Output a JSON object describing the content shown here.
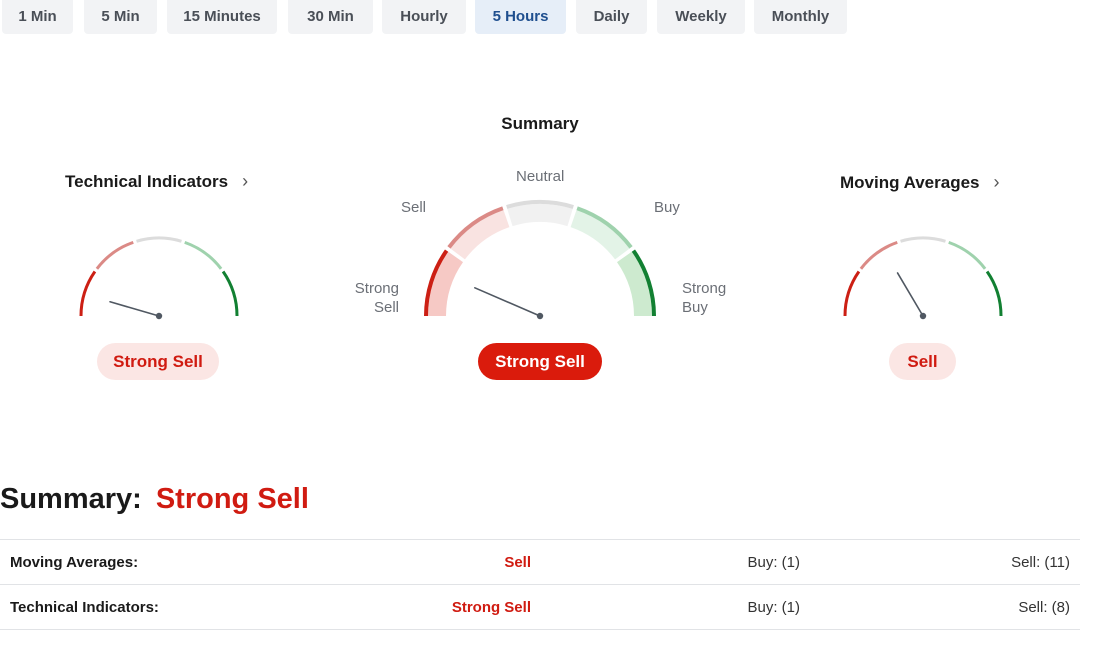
{
  "timeframes": [
    {
      "label": "1 Min",
      "active": false
    },
    {
      "label": "5 Min",
      "active": false
    },
    {
      "label": "15 Minutes",
      "active": false
    },
    {
      "label": "30 Min",
      "active": false
    },
    {
      "label": "Hourly",
      "active": false
    },
    {
      "label": "5 Hours",
      "active": true
    },
    {
      "label": "Daily",
      "active": false
    },
    {
      "label": "Weekly",
      "active": false
    },
    {
      "label": "Monthly",
      "active": false
    }
  ],
  "gauges": {
    "summary": {
      "title": "Summary",
      "labels": {
        "neutral": "Neutral",
        "sell": "Sell",
        "buy": "Buy",
        "strong_sell": "Strong\nSell",
        "strong_buy": "Strong\nBuy"
      },
      "result": "Strong Sell",
      "needle_level": 0.13
    },
    "technical": {
      "title": "Technical Indicators",
      "result": "Strong Sell",
      "needle_level": 0.09
    },
    "moving": {
      "title": "Moving Averages",
      "result": "Sell",
      "needle_level": 0.33
    }
  },
  "summary": {
    "label": "Summary:",
    "value": "Strong Sell"
  },
  "table": {
    "rows": [
      {
        "name": "Moving Averages:",
        "status": "Sell",
        "buy": "Buy: (1)",
        "sell": "Sell: (11)"
      },
      {
        "name": "Technical Indicators:",
        "status": "Strong Sell",
        "buy": "Buy: (1)",
        "sell": "Sell: (8)"
      }
    ]
  },
  "colors": {
    "strong_sell": "#cc1f14",
    "sell": "#db8a86",
    "neutral": "#dcdcdc",
    "buy": "#9fd2ad",
    "strong_buy": "#128032",
    "needle": "#505862"
  }
}
